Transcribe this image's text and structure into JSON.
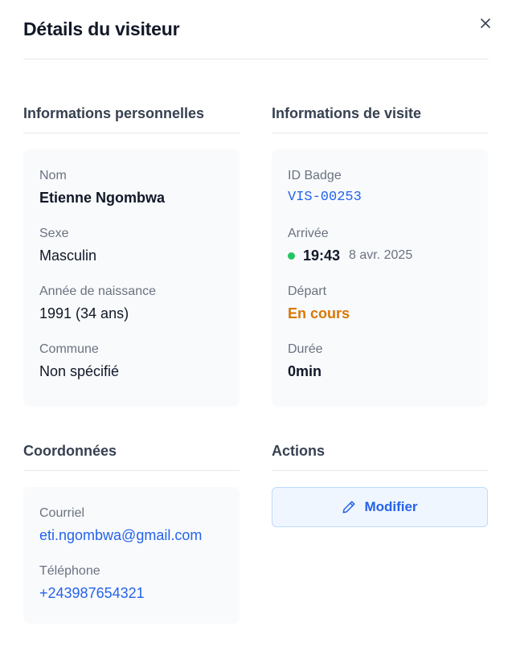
{
  "modal": {
    "title": "Détails du visiteur"
  },
  "personal": {
    "title": "Informations personnelles",
    "name_label": "Nom",
    "name_value": "Etienne Ngombwa",
    "sex_label": "Sexe",
    "sex_value": "Masculin",
    "birth_label": "Année de naissance",
    "birth_value": "1991 (34 ans)",
    "commune_label": "Commune",
    "commune_value": "Non spécifié"
  },
  "visit": {
    "title": "Informations de visite",
    "badge_label": "ID Badge",
    "badge_value": "VIS-00253",
    "arrival_label": "Arrivée",
    "arrival_time": "19:43",
    "arrival_date": "8 avr. 2025",
    "departure_label": "Départ",
    "departure_value": "En cours",
    "duration_label": "Durée",
    "duration_value": "0min"
  },
  "contact": {
    "title": "Coordonnées",
    "email_label": "Courriel",
    "email_value": "eti.ngombwa@gmail.com",
    "phone_label": "Téléphone",
    "phone_value": "+243987654321"
  },
  "actions": {
    "title": "Actions",
    "edit_label": "Modifier"
  },
  "icons": {
    "close": "close-icon",
    "edit": "pencil-icon",
    "status": "status-dot-icon"
  },
  "colors": {
    "accent": "#2563eb",
    "status_active": "#22c55e",
    "in_progress": "#d97706"
  }
}
